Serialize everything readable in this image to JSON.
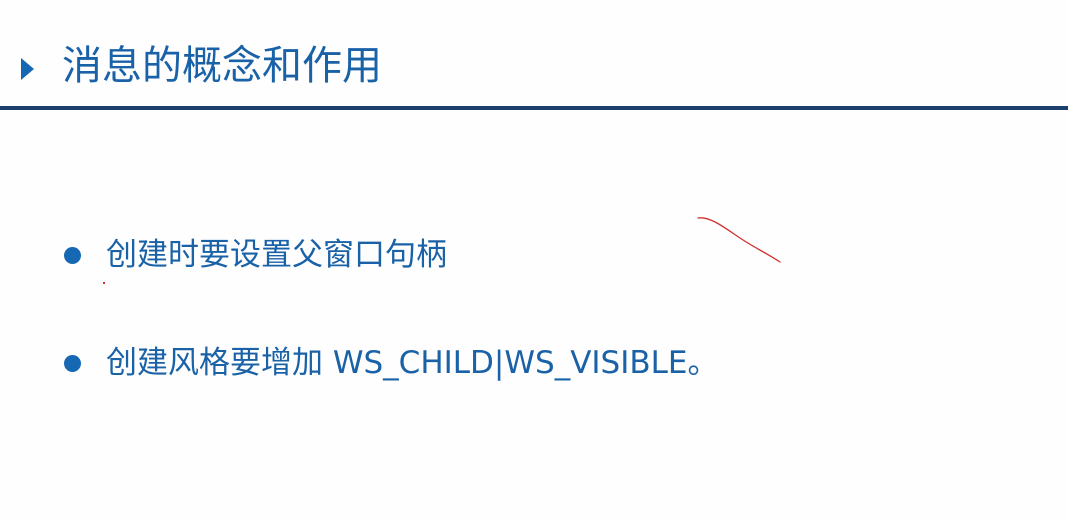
{
  "slide": {
    "title": "消息的概念和作用",
    "bullets": [
      {
        "text": "创建时要设置父窗口句柄"
      },
      {
        "text": "创建风格要增加 WS_CHILD|WS_VISIBLE。"
      }
    ]
  },
  "colors": {
    "accent": "#1a62a7",
    "rule": "#1d3f6c",
    "annotation": "#d03030",
    "background": "#fefefe"
  },
  "icons": {
    "title_marker": "right-triangle-icon",
    "bullet_marker": "round-bullet-icon"
  }
}
